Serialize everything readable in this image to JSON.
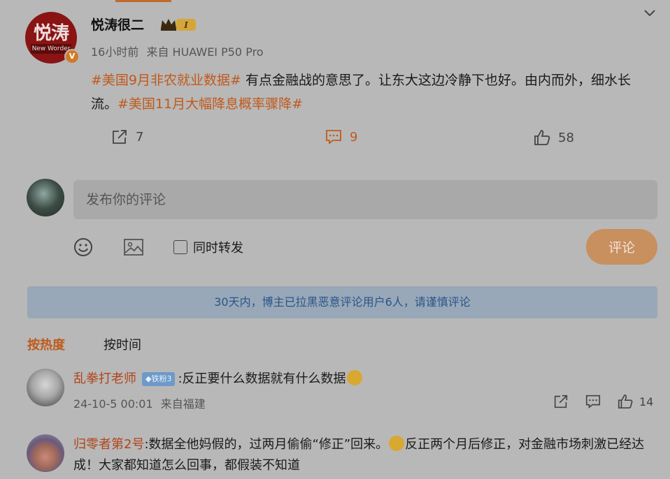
{
  "post": {
    "username": "悦涛很二",
    "avatar_logo": "悦涛",
    "avatar_logo_sub": "New Worder",
    "verified_badge": "V",
    "level_badge": "I",
    "time": "16小时前",
    "source": "来自 HUAWEI P50 Pro",
    "tag1": "#美国9月非农就业数据#",
    "text1": " 有点金融战的意思了。让东大这边冷静下也好。由内而外，细水长流。",
    "tag2": "#美国11月大幅降息概率骤降#",
    "repost_count": "7",
    "comment_count": "9",
    "like_count": "58"
  },
  "composer": {
    "placeholder": "发布你的评论",
    "repost_label": "同时转发",
    "submit_label": "评论"
  },
  "notice": "30天内，博主已拉黑恶意评论用户6人，请谨慎评论",
  "sort": {
    "hot": "按热度",
    "time": "按时间"
  },
  "comments": [
    {
      "user": "乱拳打老师",
      "badge": "◆铁粉3",
      "text": ":反正要什么数据就有什么数据",
      "time": "24-10-5 00:01",
      "location": "来自福建",
      "like_count": "14"
    },
    {
      "user": "归零者第2号",
      "text_a": ":数据全他妈假的，过两月偷偷“修正”回来。",
      "text_b": "反正两个月后修正，对金融市场刺激已经达成！大家都知道怎么回事，都假装不知道"
    }
  ],
  "colors": {
    "accent": "#c05a1c",
    "notice_text": "#2b5488",
    "background": "#b8b8b8"
  }
}
